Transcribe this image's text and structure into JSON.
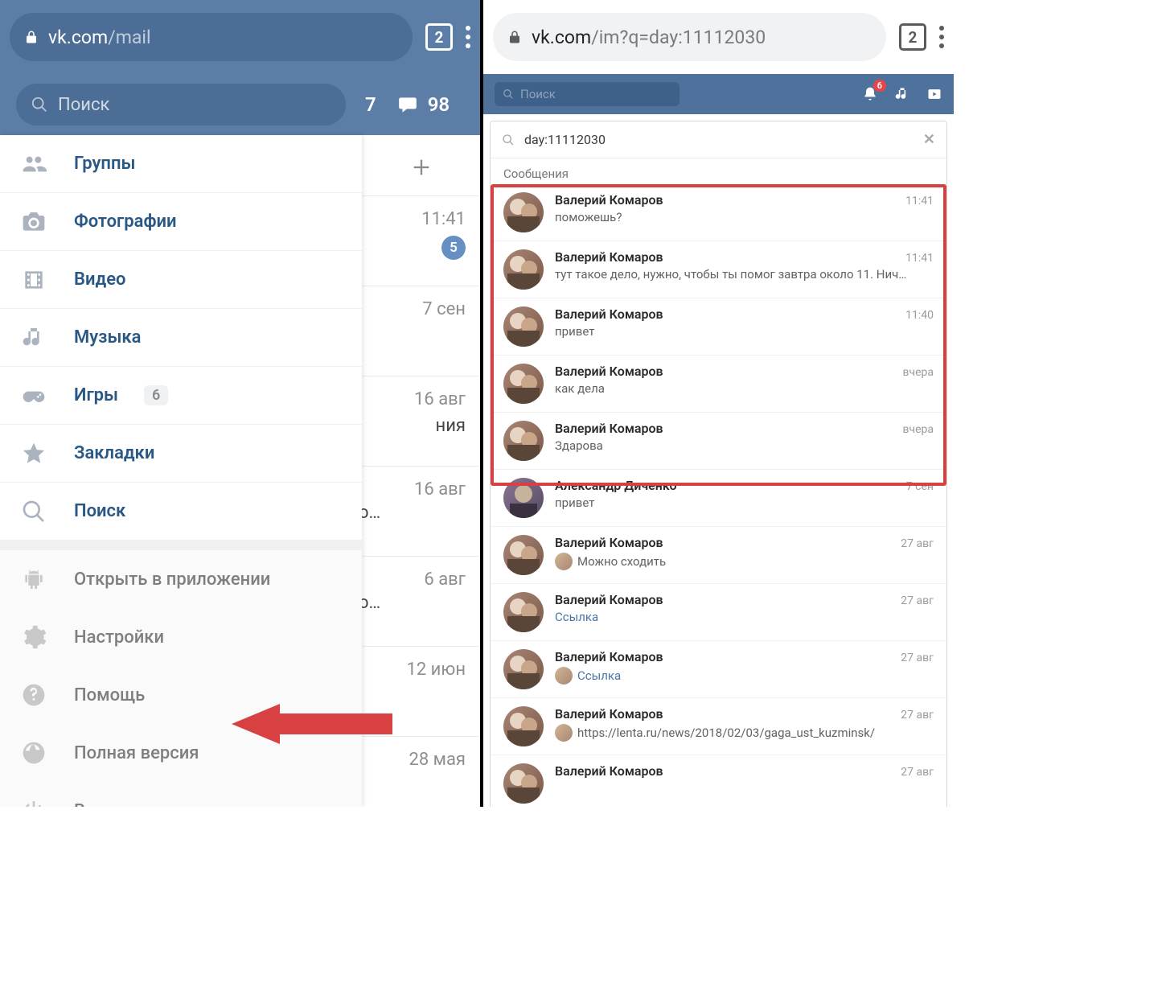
{
  "left": {
    "browser": {
      "host": "vk.com",
      "path": "/mail",
      "tab_count": "2"
    },
    "search_placeholder": "Поиск",
    "count_left": "7",
    "count_messages": "98",
    "menu": [
      {
        "label": "Группы",
        "icon": "users"
      },
      {
        "label": "Фотографии",
        "icon": "camera"
      },
      {
        "label": "Видео",
        "icon": "film"
      },
      {
        "label": "Музыка",
        "icon": "music"
      },
      {
        "label": "Игры",
        "icon": "gamepad",
        "badge": "6"
      },
      {
        "label": "Закладки",
        "icon": "star"
      },
      {
        "label": "Поиск",
        "icon": "search"
      }
    ],
    "secondary_menu": [
      {
        "label": "Открыть в приложении",
        "icon": "android"
      },
      {
        "label": "Настройки",
        "icon": "gear"
      },
      {
        "label": "Помощь",
        "icon": "help"
      },
      {
        "label": "Полная версия",
        "icon": "globe"
      },
      {
        "label": "Выход",
        "icon": "logout"
      }
    ],
    "bg_rows": [
      {
        "type": "plus"
      },
      {
        "time": "11:41",
        "unread": "5"
      },
      {
        "time": "7 сен"
      },
      {
        "time": "16 авг",
        "extra": "ния"
      },
      {
        "time": "16 авг",
        "extra": "о…"
      },
      {
        "time": "6 авг",
        "extra": "о…"
      },
      {
        "time": "12 июн"
      },
      {
        "time": "28 мая"
      }
    ]
  },
  "right": {
    "browser": {
      "host": "vk.com",
      "path": "/im?q=day:11112030",
      "tab_count": "2"
    },
    "search_placeholder": "Поиск",
    "notif_count": "6",
    "im_search_value": "day:11112030",
    "messages_header": "Сообщения",
    "messages": [
      {
        "name": "Валерий Комаров",
        "time": "11:41",
        "preview": "поможешь?"
      },
      {
        "name": "Валерий Комаров",
        "time": "11:41",
        "preview": "тут такое дело, нужно, чтобы ты помог завтра около 11. Нич…"
      },
      {
        "name": "Валерий Комаров",
        "time": "11:40",
        "preview": "привет"
      },
      {
        "name": "Валерий Комаров",
        "time": "вчера",
        "preview": "как дела"
      },
      {
        "name": "Валерий Комаров",
        "time": "вчера",
        "preview": "Здарова"
      },
      {
        "name": "Александр Диченко",
        "time": "7 сен",
        "preview": "привет",
        "alt_avatar": true
      },
      {
        "name": "Валерий Комаров",
        "time": "27 авг",
        "preview": "Можно сходить",
        "mini": true
      },
      {
        "name": "Валерий Комаров",
        "time": "27 авг",
        "preview": "Ссылка",
        "link": true
      },
      {
        "name": "Валерий Комаров",
        "time": "27 авг",
        "preview": "Ссылка",
        "mini": true,
        "mini_link": true
      },
      {
        "name": "Валерий Комаров",
        "time": "27 авг",
        "preview": "https://lenta.ru/news/2018/02/03/gaga_ust_kuzminsk/",
        "mini": true
      },
      {
        "name": "Валерий Комаров",
        "time": "27 авг",
        "preview": ""
      }
    ]
  }
}
